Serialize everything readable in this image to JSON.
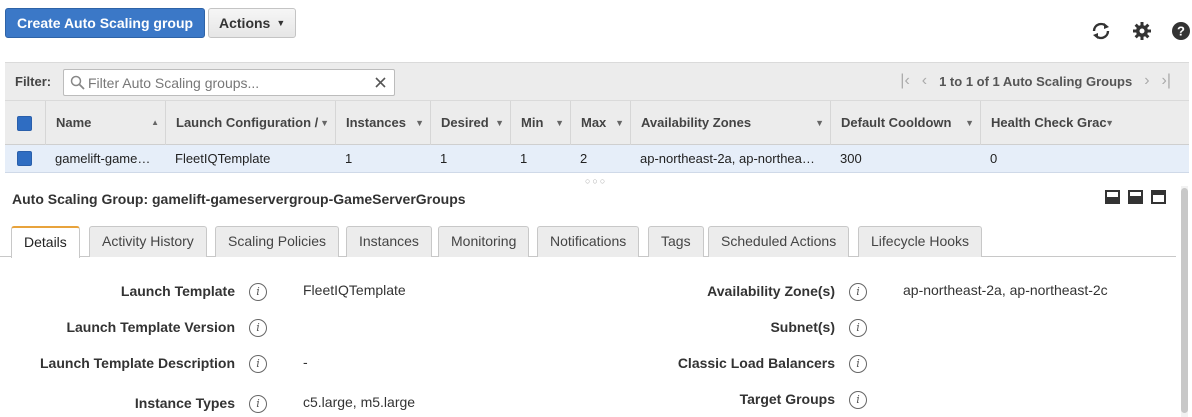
{
  "toolbar": {
    "create_label": "Create Auto Scaling group",
    "actions_label": "Actions",
    "icons": [
      "refresh-icon",
      "gear-icon",
      "help-icon"
    ]
  },
  "filter": {
    "label": "Filter:",
    "placeholder": "Filter Auto Scaling groups...",
    "value": ""
  },
  "pager": {
    "text": "1 to 1 of 1 Auto Scaling Groups"
  },
  "table": {
    "columns": [
      "Name",
      "Launch Configuration /",
      "Instances",
      "Desired",
      "Min",
      "Max",
      "Availability Zones",
      "Default Cooldown",
      "Health Check Grac"
    ],
    "rows": [
      {
        "name": "gamelift-game…",
        "launch_config": "FleetIQTemplate",
        "instances": "1",
        "desired": "1",
        "min": "1",
        "max": "2",
        "zones": "ap-northeast-2a, ap-northea…",
        "cooldown": "300",
        "health_grace": "0"
      }
    ]
  },
  "detail": {
    "title": "Auto Scaling Group: gamelift-gameservergroup-GameServerGroups",
    "tabs": [
      "Details",
      "Activity History",
      "Scaling Policies",
      "Instances",
      "Monitoring",
      "Notifications",
      "Tags",
      "Scheduled Actions",
      "Lifecycle Hooks"
    ],
    "active_tab": "Details",
    "left_fields": [
      {
        "label": "Launch Template",
        "value": "FleetIQTemplate"
      },
      {
        "label": "Launch Template Version",
        "value": ""
      },
      {
        "label": "Launch Template Description",
        "value": "-"
      },
      {
        "label": "Instance Types",
        "value": "c5.large, m5.large"
      }
    ],
    "right_fields": [
      {
        "label": "Availability Zone(s)",
        "value": "ap-northeast-2a, ap-northeast-2c"
      },
      {
        "label": "Subnet(s)",
        "value": ""
      },
      {
        "label": "Classic Load Balancers",
        "value": ""
      },
      {
        "label": "Target Groups",
        "value": ""
      }
    ]
  },
  "colors": {
    "primary": "#3b78c7",
    "active_tab_accent": "#e8a33c",
    "selected_row": "#e6eef9"
  }
}
